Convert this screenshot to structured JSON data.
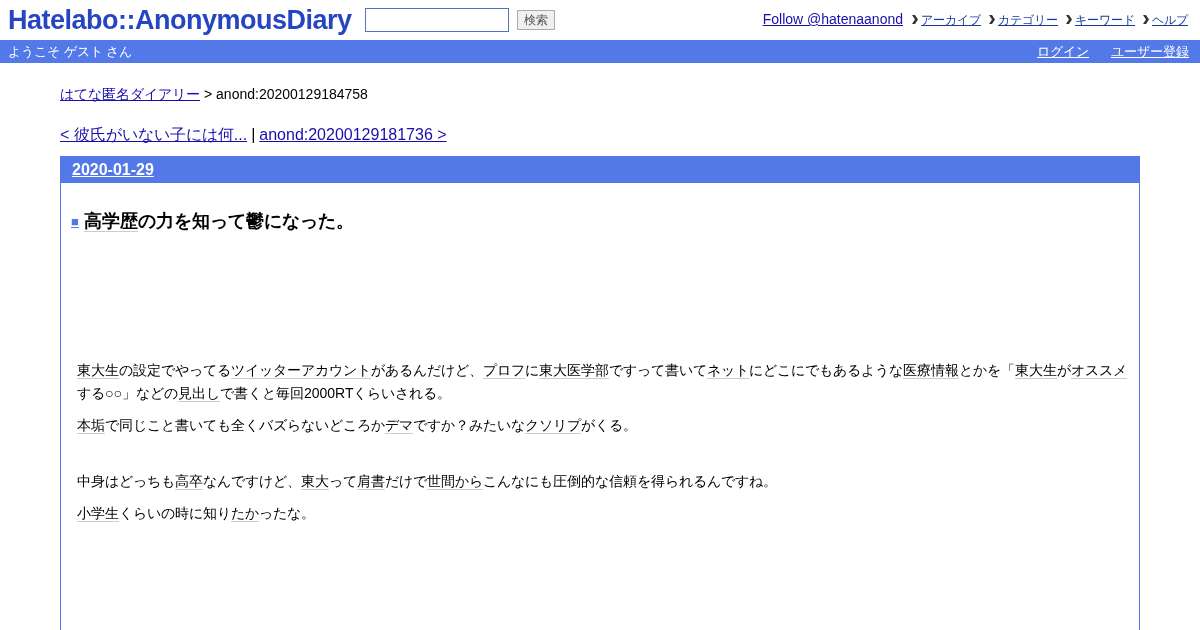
{
  "header": {
    "logo": "Hatelabo::AnonymousDiary",
    "search": {
      "button": "検索"
    },
    "follow": "Follow @hatenaanond",
    "nav": [
      "アーカイブ",
      "カテゴリー",
      "キーワード",
      "ヘルプ"
    ]
  },
  "user_bar": {
    "welcome": "ようこそ ゲスト さん",
    "links": [
      "ログイン",
      "ユーザー登録"
    ]
  },
  "breadcrumb": {
    "link": "はてな匿名ダイアリー",
    "current": "> anond:20200129184758"
  },
  "pager": {
    "prev": "< 彼氏がいない子には何...",
    "separator": "|",
    "next": "anond:20200129181736 >"
  },
  "day": {
    "date": "2020-01-29",
    "title": {
      "marker": "■",
      "segments": [
        {
          "text": "高学歴",
          "keyword": true
        },
        {
          "text": "の力を知って鬱になった。",
          "keyword": false
        }
      ]
    },
    "sections": [
      {
        "paragraphs": [
          [
            {
              "text": "東大生",
              "keyword": true
            },
            {
              "text": "の設定でやってる",
              "keyword": false
            },
            {
              "text": "ツイッターアカウント",
              "keyword": true
            },
            {
              "text": "があるんだけど、",
              "keyword": false
            },
            {
              "text": "プロフ",
              "keyword": true
            },
            {
              "text": "に",
              "keyword": false
            },
            {
              "text": "東大医学部",
              "keyword": true
            },
            {
              "text": "ですって書いて",
              "keyword": false
            },
            {
              "text": "ネット",
              "keyword": true
            },
            {
              "text": "にどこにでもあるような",
              "keyword": false
            },
            {
              "text": "医療情報",
              "keyword": true
            },
            {
              "text": "とかを「",
              "keyword": false
            },
            {
              "text": "東大生",
              "keyword": true
            },
            {
              "text": "が",
              "keyword": false
            },
            {
              "text": "オススメ",
              "keyword": true
            },
            {
              "text": "する○○」などの",
              "keyword": false
            },
            {
              "text": "見出し",
              "keyword": true
            },
            {
              "text": "で書くと毎回2000RTくらいされる。",
              "keyword": false
            }
          ],
          [
            {
              "text": "本垢",
              "keyword": true
            },
            {
              "text": "で同じこと書いても全くバズらないどころか",
              "keyword": false
            },
            {
              "text": "デマ",
              "keyword": true
            },
            {
              "text": "ですか？みたいな",
              "keyword": false
            },
            {
              "text": "クソリプ",
              "keyword": true
            },
            {
              "text": "がくる。",
              "keyword": false
            }
          ]
        ]
      },
      {
        "paragraphs": [
          [
            {
              "text": "中身はどっちも",
              "keyword": false
            },
            {
              "text": "高卒",
              "keyword": true
            },
            {
              "text": "なんですけど、",
              "keyword": false
            },
            {
              "text": "東大",
              "keyword": true
            },
            {
              "text": "って",
              "keyword": false
            },
            {
              "text": "肩書",
              "keyword": true
            },
            {
              "text": "だけで",
              "keyword": false
            },
            {
              "text": "世間から",
              "keyword": true
            },
            {
              "text": "こんなにも圧倒的な信頼を得られるんですね。",
              "keyword": false
            }
          ],
          [
            {
              "text": "小学生",
              "keyword": true
            },
            {
              "text": "くらいの時に知り",
              "keyword": false
            },
            {
              "text": "たか",
              "keyword": true
            },
            {
              "text": "ったな。",
              "keyword": false
            }
          ]
        ]
      }
    ]
  }
}
